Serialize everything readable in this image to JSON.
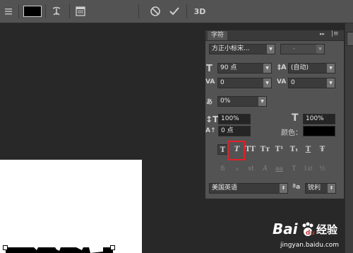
{
  "toolbar": {
    "color_swatch": "#000000",
    "icons": [
      "paragraph-icon",
      "warp-text-icon",
      "panel-toggle-icon",
      "cancel-icon",
      "commit-icon"
    ],
    "mode_3d": "3D"
  },
  "panel": {
    "tab": "字符",
    "font_family": "方正小标宋...",
    "font_style": "-",
    "font_size": "90 点",
    "leading": "(自动)",
    "kerning": "0",
    "tracking": "0",
    "tsume": "0%",
    "vertical_scale": "100%",
    "horizontal_scale": "100%",
    "baseline_shift": "0 点",
    "color_label": "颜色：",
    "color_value": "#000000",
    "style_buttons": [
      "T",
      "T",
      "TT",
      "Tт",
      "T¹",
      "T₁",
      "T",
      "Ŧ"
    ],
    "opentype_buttons": [
      "fi",
      "ℴ",
      "st",
      "A",
      "aa",
      "T",
      "1st",
      "½"
    ],
    "language": "美国英语",
    "aa_icon_label": "ªa",
    "antialias": "锐利"
  },
  "watermark": {
    "brand": "Bai",
    "brand_suffix": "经验",
    "url": "jingyan.baidu.com"
  }
}
